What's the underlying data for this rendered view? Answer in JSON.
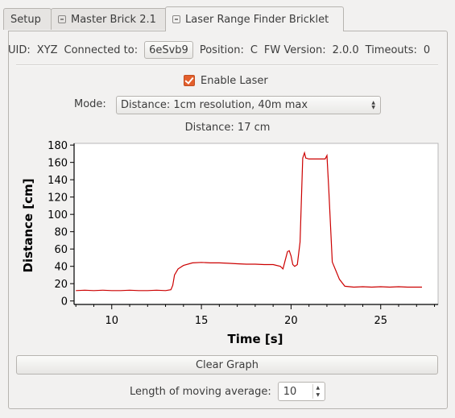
{
  "tabs": [
    {
      "label": "Setup",
      "active": false,
      "icon": null
    },
    {
      "label": "Master Brick 2.1",
      "active": false,
      "icon": "brick-icon"
    },
    {
      "label": "Laser Range Finder Bricklet",
      "active": true,
      "icon": "brick-icon"
    }
  ],
  "info": {
    "uid_label": "UID:",
    "uid_value": "XYZ",
    "connected_label": "Connected to:",
    "connected_value": "6eSvb9",
    "position_label": "Position:",
    "position_value": "C",
    "fw_label": "FW Version:",
    "fw_value": "2.0.0",
    "timeouts_label": "Timeouts:",
    "timeouts_value": "0"
  },
  "enable_laser": {
    "label": "Enable Laser",
    "checked": true
  },
  "mode": {
    "label": "Mode:",
    "selected": "Distance: 1cm resolution, 40m max"
  },
  "distance_label": "Distance: 17 cm",
  "colors": {
    "accent": "#e35f2c",
    "plot_line": "#cc0000"
  },
  "chart_data": {
    "type": "line",
    "xlabel": "Time [s]",
    "ylabel": "Distance [cm]",
    "xlim": [
      7.9,
      28.2
    ],
    "ylim": [
      -4,
      182
    ],
    "x_ticks": [
      10,
      15,
      20,
      25
    ],
    "y_ticks": [
      0,
      20,
      40,
      60,
      80,
      100,
      120,
      140,
      160,
      180
    ],
    "series": [
      {
        "x": [
          8.0,
          8.5,
          9.0,
          9.5,
          10.0,
          10.5,
          11.0,
          11.5,
          12.0,
          12.5,
          13.0,
          13.3,
          13.4,
          13.5,
          13.7,
          14.0,
          14.5,
          15.0,
          15.5,
          16.0,
          16.5,
          17.0,
          17.5,
          18.0,
          18.5,
          19.0,
          19.4,
          19.55,
          19.65,
          19.8,
          19.9,
          20.0,
          20.1,
          20.2,
          20.35,
          20.5,
          20.65,
          20.75,
          20.82,
          21.0,
          21.3,
          21.6,
          21.9,
          22.0,
          22.1,
          22.3,
          22.5,
          22.7,
          23.0,
          23.5,
          24.0,
          24.5,
          25.0,
          25.5,
          26.0,
          26.5,
          27.0,
          27.3
        ],
        "y": [
          12,
          12.5,
          12,
          12.5,
          12,
          12,
          12.5,
          12,
          12,
          12.5,
          12,
          13,
          18,
          30,
          37,
          41,
          44,
          44.5,
          44,
          44,
          43.5,
          43,
          42.5,
          42.5,
          42,
          42,
          40,
          37,
          45,
          57,
          58,
          52,
          42,
          40,
          42,
          68,
          165,
          171,
          165,
          164,
          164,
          164,
          164,
          168,
          130,
          45,
          35,
          25,
          17,
          16,
          16.5,
          16,
          16.5,
          16,
          16.5,
          16,
          16,
          16
        ]
      }
    ]
  },
  "clear_button": "Clear Graph",
  "moving_average": {
    "label": "Length of moving average:",
    "value": "10"
  }
}
